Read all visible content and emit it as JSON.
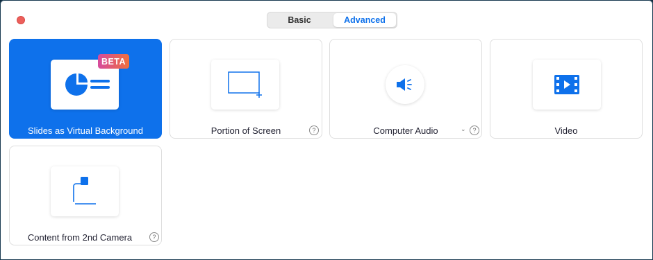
{
  "tabs": [
    {
      "label": "Basic",
      "active": false
    },
    {
      "label": "Advanced",
      "active": true
    }
  ],
  "cards": [
    {
      "id": "slides",
      "label": "Slides as Virtual Background",
      "selected": true,
      "badge": "BETA",
      "icon": "slides-pie-icon"
    },
    {
      "id": "portion",
      "label": "Portion of Screen",
      "help": "?",
      "icon": "screen-portion-icon"
    },
    {
      "id": "audio",
      "label": "Computer Audio",
      "dropdown": "⌄",
      "help": "?",
      "icon": "speaker-icon"
    },
    {
      "id": "video",
      "label": "Video",
      "icon": "film-icon"
    },
    {
      "id": "camera",
      "label": "Content from 2nd Camera",
      "help": "?",
      "icon": "document-camera-icon"
    }
  ],
  "colors": {
    "accent": "#0e71eb",
    "close": "#ec5f5b",
    "beta_start": "#d64b9e",
    "beta_end": "#f0703c"
  }
}
